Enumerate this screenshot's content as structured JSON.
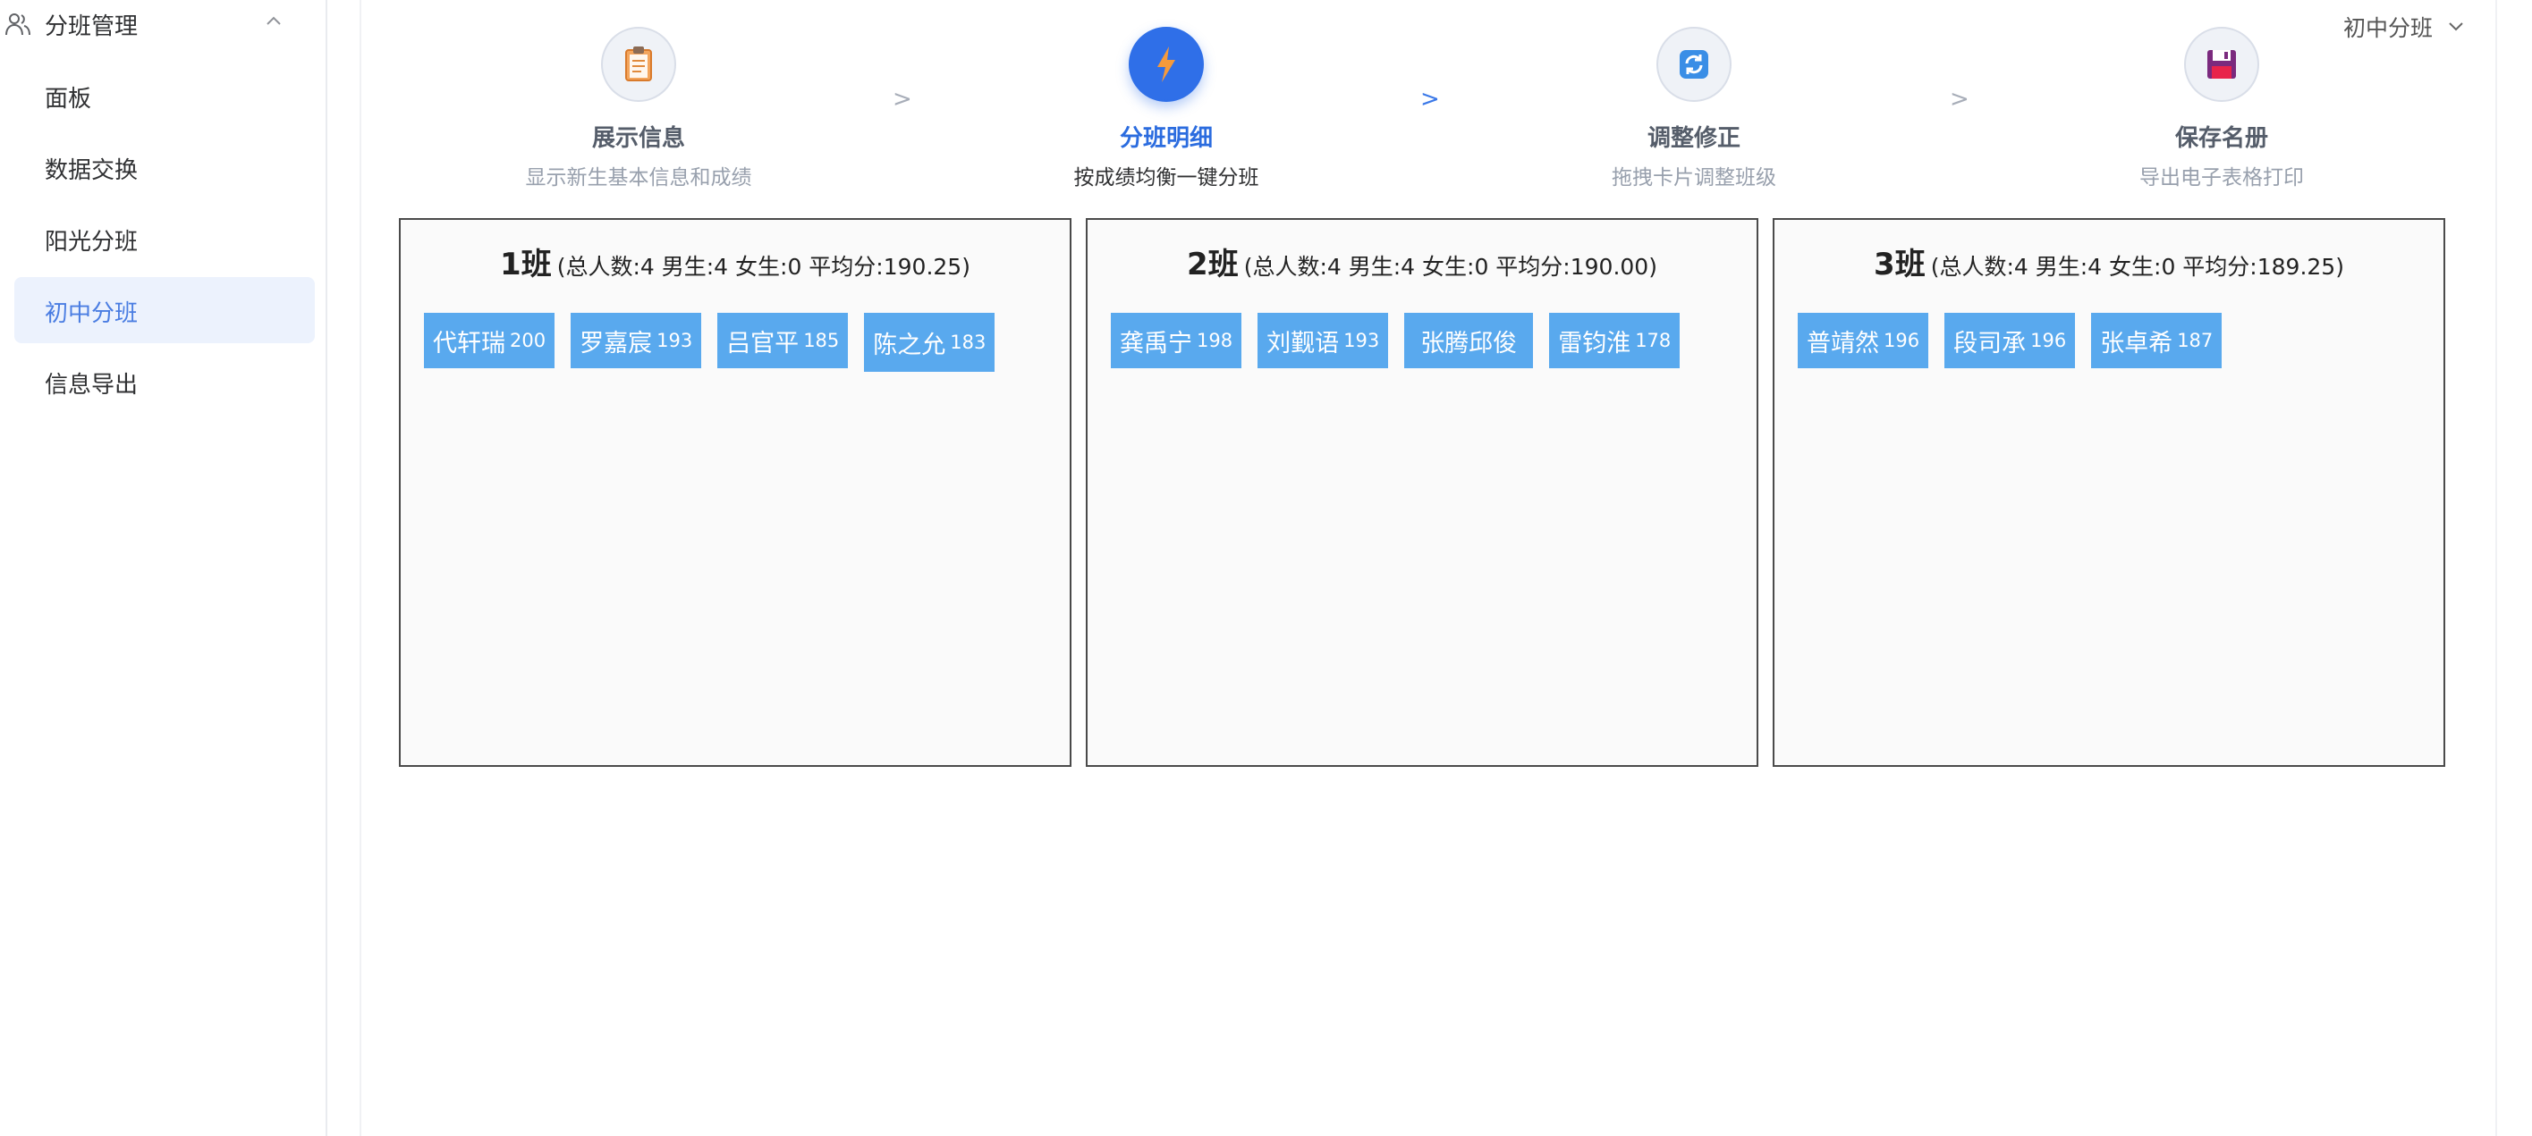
{
  "sidebar": {
    "group_label": "分班管理",
    "items": [
      {
        "label": "面板",
        "active": false
      },
      {
        "label": "数据交换",
        "active": false
      },
      {
        "label": "阳光分班",
        "active": false
      },
      {
        "label": "初中分班",
        "active": true
      },
      {
        "label": "信息导出",
        "active": false
      }
    ]
  },
  "header": {
    "select_value": "初中分班"
  },
  "steps": [
    {
      "title": "展示信息",
      "desc": "显示新生基本信息和成绩",
      "icon": "clipboard-icon",
      "active": false
    },
    {
      "title": "分班明细",
      "desc": "按成绩均衡一键分班",
      "icon": "lightning-icon",
      "active": true
    },
    {
      "title": "调整修正",
      "desc": "拖拽卡片调整班级",
      "icon": "refresh-icon",
      "active": false
    },
    {
      "title": "保存名册",
      "desc": "导出电子表格打印",
      "icon": "floppy-disk-icon",
      "active": false
    }
  ],
  "step_separator": ">",
  "classes": [
    {
      "name": "1班",
      "info": "(总人数:4 男生:4 女生:0 平均分:190.25)",
      "students": [
        {
          "name": "代轩瑞",
          "score": "200"
        },
        {
          "name": "罗嘉宸",
          "score": "193"
        },
        {
          "name": "吕官平",
          "score": "185"
        },
        {
          "name": "陈之允",
          "score": "183"
        }
      ]
    },
    {
      "name": "2班",
      "info": "(总人数:4 男生:4 女生:0 平均分:190.00)",
      "students": [
        {
          "name": "龚禹宁",
          "score": "198"
        },
        {
          "name": "刘觐语",
          "score": "193"
        },
        {
          "name": "张腾邱俊",
          "score": ""
        },
        {
          "name": "雷钧淮",
          "score": "178"
        }
      ]
    },
    {
      "name": "3班",
      "info": "(总人数:4 男生:4 女生:0 平均分:189.25)",
      "students": [
        {
          "name": "普靖然",
          "score": "196"
        },
        {
          "name": "段司承",
          "score": "196"
        },
        {
          "name": "张卓希",
          "score": "187"
        }
      ]
    }
  ],
  "colors": {
    "accent": "#2f6fe8",
    "card": "#59a9ee",
    "active_bg": "#ecf2fd"
  }
}
